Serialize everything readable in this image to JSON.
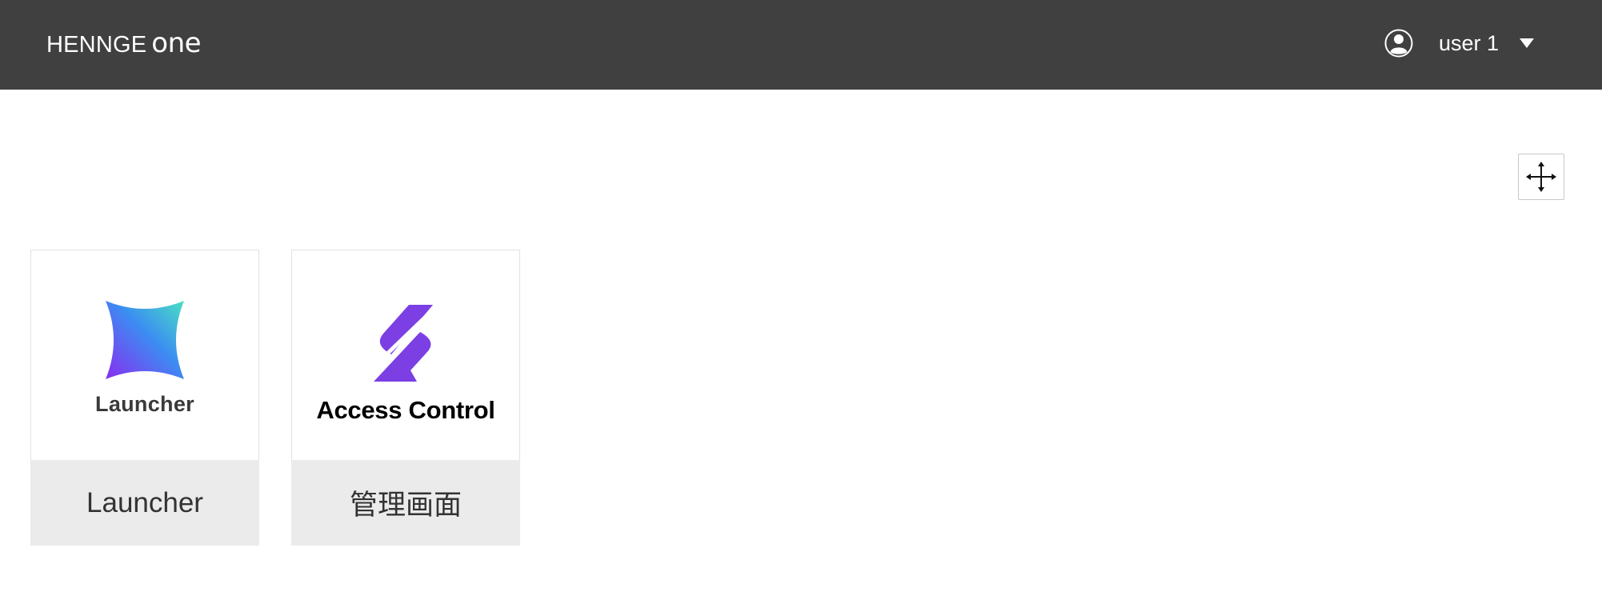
{
  "header": {
    "brand_primary": "HENNGE",
    "brand_secondary": "one",
    "user_icon": "user-circle-icon",
    "user_name": "user 1",
    "dropdown_icon": "caret-down-icon",
    "background_color": "#404040"
  },
  "toolbar": {
    "move_icon": "move-arrows-icon"
  },
  "apps": [
    {
      "logo_icon": "launcher-star-icon",
      "logo_text": "Launcher",
      "label": "Launcher"
    },
    {
      "logo_icon": "access-control-z-icon",
      "logo_text": "Access Control",
      "label": "管理画面"
    }
  ],
  "colors": {
    "tile_footer": "#ebebeb",
    "accent_purple": "#7b3fe4"
  }
}
